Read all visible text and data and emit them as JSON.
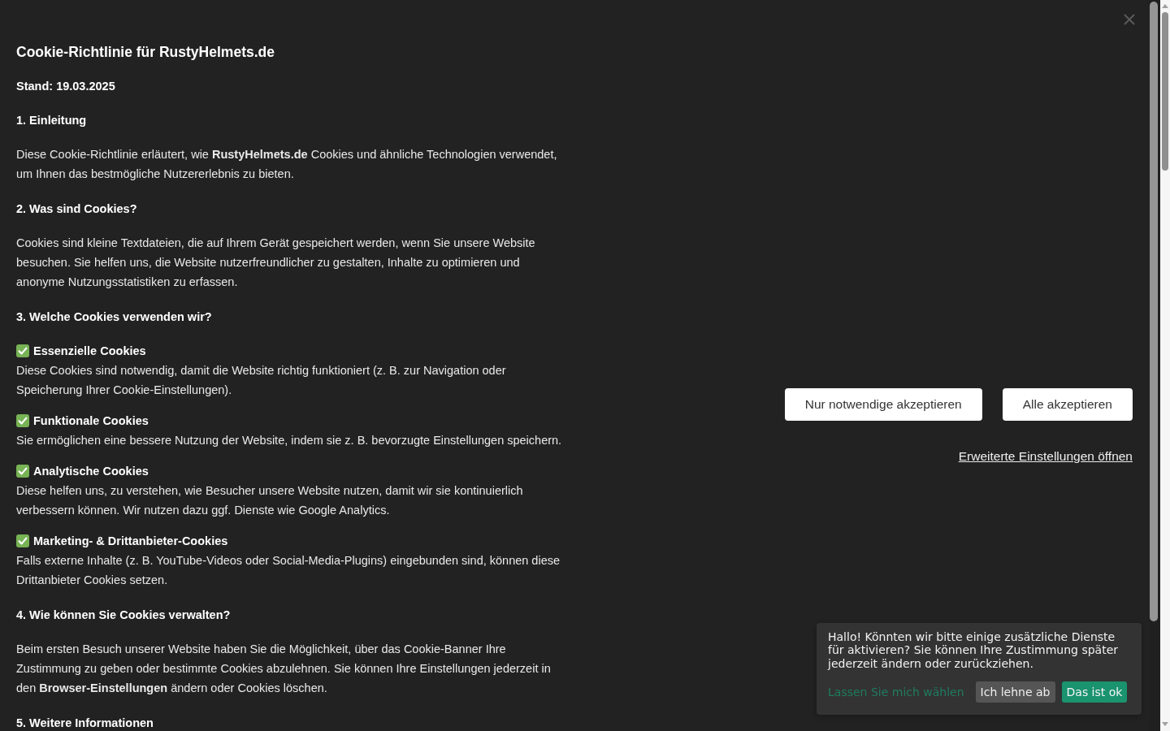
{
  "policy": {
    "title": "Cookie-Richtlinie für RustyHelmets.de",
    "date": "Stand: 19.03.2025",
    "sections": [
      {
        "heading": "1. Einleitung",
        "paragraphs": [
          "Diese Cookie-Richtlinie erläutert, wie **RustyHelmets.de** Cookies und ähnliche Technologien verwendet, um Ihnen das bestmögliche Nutzererlebnis zu bieten."
        ]
      },
      {
        "heading": "2. Was sind Cookies?",
        "paragraphs": [
          "Cookies sind kleine Textdateien, die auf Ihrem Gerät gespeichert werden, wenn Sie unsere Website besuchen. Sie helfen uns, die Website nutzerfreundlicher zu gestalten, Inhalte zu optimieren und anonyme Nutzungsstatistiken zu erfassen."
        ]
      },
      {
        "heading": "3. Welche Cookies verwenden wir?",
        "cookie_types": [
          {
            "name": "Essenzielle Cookies",
            "description": "Diese Cookies sind notwendig, damit die Website richtig funktioniert (z. B. zur Navigation oder Speicherung Ihrer Cookie-Einstellungen)."
          },
          {
            "name": "Funktionale Cookies",
            "description": "Sie ermöglichen eine bessere Nutzung der Website, indem sie z. B. bevorzugte Einstellungen speichern."
          },
          {
            "name": "Analytische Cookies",
            "description": "Diese helfen uns, zu verstehen, wie Besucher unsere Website nutzen, damit wir sie kontinuierlich verbessern können. Wir nutzen dazu ggf. Dienste wie Google Analytics."
          },
          {
            "name": "Marketing- & Drittanbieter-Cookies",
            "description": "Falls externe Inhalte (z. B. YouTube-Videos oder Social-Media-Plugins) eingebunden sind, können diese Drittanbieter Cookies setzen."
          }
        ]
      },
      {
        "heading": "4. Wie können Sie Cookies verwalten?",
        "paragraphs": [
          "Beim ersten Besuch unserer Website haben Sie die Möglichkeit, über das Cookie-Banner Ihre Zustimmung zu geben oder bestimmte Cookies abzulehnen. Sie können Ihre Einstellungen jederzeit in den **Browser-Einstellungen** ändern oder Cookies löschen."
        ]
      },
      {
        "heading": "5. Weitere Informationen"
      }
    ]
  },
  "consent_actions": {
    "buttons": [
      "Nur notwendige akzeptieren",
      "Alle akzeptieren"
    ],
    "settings_link": "Erweiterte Einstellungen öffnen"
  },
  "consent_popup": {
    "message": "Hallo! Könnten wir bitte einige zusätzliche Dienste für aktivieren? Sie können Ihre Zustimmung später jederzeit ändern oder zurückziehen.",
    "actions": [
      {
        "kind": "link",
        "label": "Lassen Sie mich wählen"
      },
      {
        "kind": "decline",
        "label": "Ich lehne ab"
      },
      {
        "kind": "accept",
        "label": "Das ist ok"
      }
    ]
  }
}
